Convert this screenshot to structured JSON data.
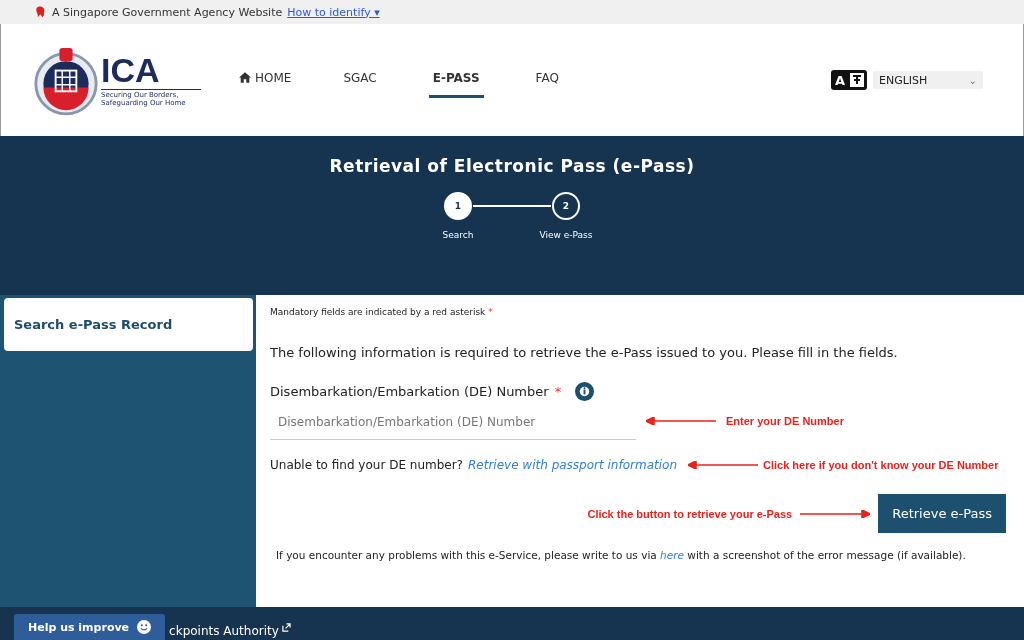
{
  "masthead": {
    "text": "A Singapore Government Agency Website",
    "link": "How to identify",
    "caret": "▾"
  },
  "header": {
    "logo": {
      "name": "ICA",
      "tagline": "Securing Our Borders, Safeguarding Our Home"
    },
    "nav": [
      {
        "label": "HOME",
        "kind": "home",
        "selected": false
      },
      {
        "label": "SGAC",
        "kind": "plain",
        "selected": false
      },
      {
        "label": "E-PASS",
        "kind": "plain",
        "selected": true
      },
      {
        "label": "FAQ",
        "kind": "plain",
        "selected": false
      }
    ],
    "language": {
      "icon_letter": "A",
      "value": "ENGLISH",
      "caret": "⌄"
    }
  },
  "banner": {
    "title": "Retrieval of Electronic Pass (e-Pass)",
    "steps": [
      {
        "number": "1",
        "label": "Search",
        "selected": true
      },
      {
        "number": "2",
        "label": "View e-Pass",
        "selected": false
      }
    ]
  },
  "sidebar": {
    "items": [
      {
        "label": "Search e-Pass Record",
        "selected": true
      }
    ]
  },
  "form": {
    "mandatory_note": "Mandatory fields are indicated by a red asterisk",
    "asterisk": "*",
    "intro": "The following information is required to retrieve the e-Pass issued to you. Please fill in the fields.",
    "field": {
      "label": "Disembarkation/Embarkation (DE) Number",
      "required": true,
      "placeholder": "Disembarkation/Embarkation (DE) Number",
      "annotation": "Enter your DE Number"
    },
    "alternative": {
      "text": "Unable to find your DE number?",
      "link": "Retrieve with passport information",
      "annotation": "Click here if you don't know your DE Number"
    },
    "button": {
      "label": "Retrieve e-Pass",
      "annotation": "Click the button to retrieve your e-Pass"
    },
    "help": {
      "before": "If you encounter any problems with this e-Service, please write to us via",
      "link": "here",
      "after": "with a screenshot of the error message (if available)."
    }
  },
  "footer": {
    "feedback_button": "Help us improve",
    "text": "ckpoints Authority"
  }
}
